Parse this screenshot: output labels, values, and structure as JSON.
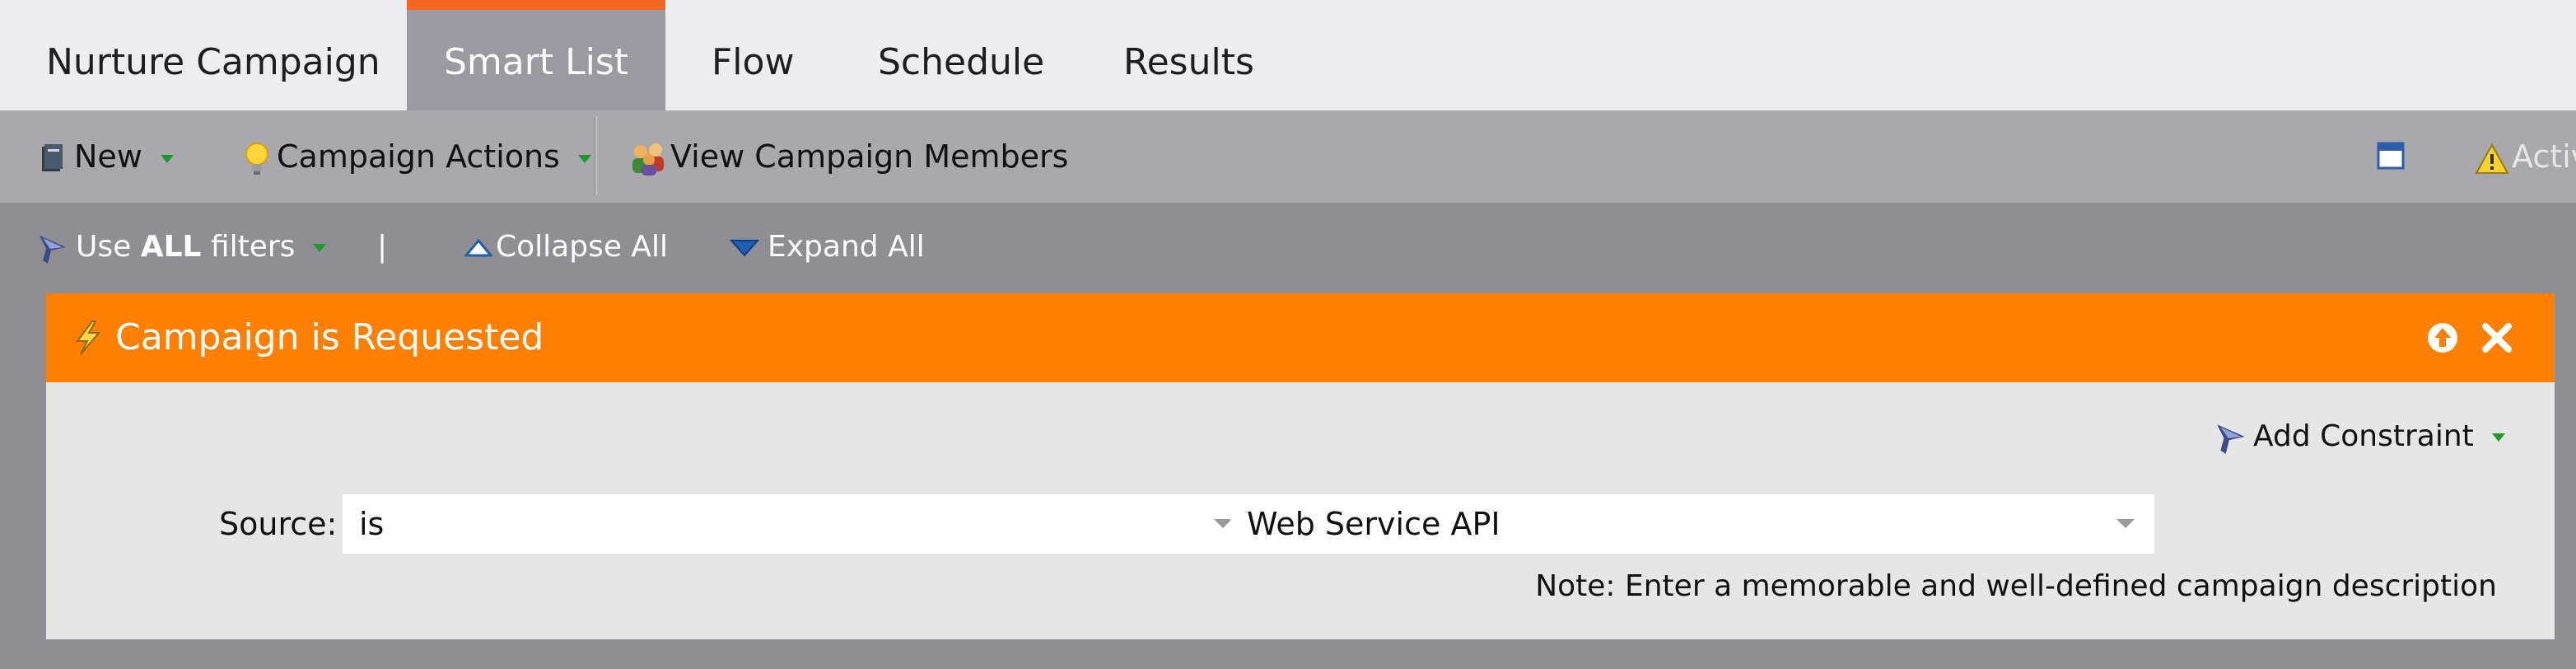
{
  "tabs": [
    {
      "label": "Nurture Campaign",
      "active": false
    },
    {
      "label": "Smart List",
      "active": true
    },
    {
      "label": "Flow",
      "active": false
    },
    {
      "label": "Schedule",
      "active": false
    },
    {
      "label": "Results",
      "active": false
    }
  ],
  "toolbar": {
    "new_label": "New",
    "campaign_actions_label": "Campaign Actions",
    "view_members_label": "View Campaign Members",
    "status_partial_label": "Activ"
  },
  "filterbar": {
    "use_prefix": "Use ",
    "use_bold": "ALL",
    "use_suffix": " filters",
    "separator": "|",
    "collapse_label": "Collapse All",
    "expand_label": "Expand All"
  },
  "trigger": {
    "title": "Campaign is Requested",
    "add_constraint_label": "Add Constraint",
    "source_label": "Source:",
    "operator_value": "is",
    "source_value": "Web Service API",
    "note": "Note: Enter a memorable and well-defined campaign description"
  },
  "colors": {
    "accent_orange": "#ff7f00",
    "tab_highlight": "#f26522",
    "caret_green": "#1a9b2c"
  },
  "icons": {
    "new": "document-icon",
    "campaign_actions": "lightbulb-icon",
    "view_members": "people-icon",
    "window": "window-icon",
    "warning": "warning-icon",
    "filter": "filter-funnel-icon",
    "collapse": "triangle-up-icon",
    "expand": "triangle-down-icon",
    "trigger": "lightning-icon",
    "move_up": "arrow-up-circle-icon",
    "close": "close-icon"
  }
}
